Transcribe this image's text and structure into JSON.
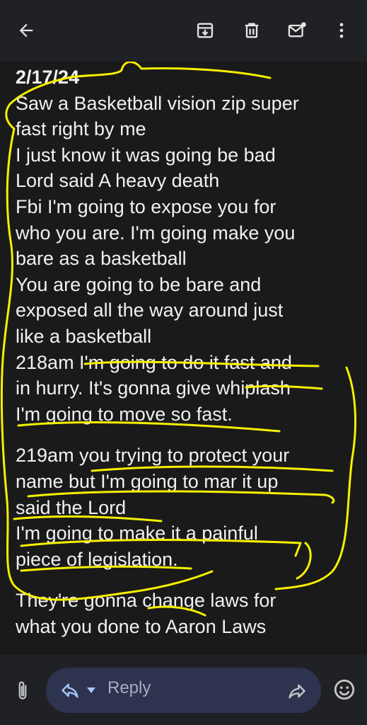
{
  "toolbar": {
    "back_icon": "arrow-left-icon",
    "actions": [
      "archive-icon",
      "trash-icon",
      "mark-unread-icon",
      "more-vert-icon"
    ]
  },
  "message": {
    "date": "2/17/24",
    "paragraphs": [
      [
        "Saw a Basketball vision zip super",
        "fast right by me",
        "I just know it was going be bad",
        "Lord said A heavy death",
        "Fbi I'm going to expose you for",
        "who you are. I'm going make you",
        "bare as a basketball",
        "You are going to be bare and",
        "exposed all the way around just",
        "like a basketball",
        "218am I'm going to do it fast and",
        "in hurry. It's gonna give whiplash",
        "I'm going to move so fast."
      ],
      [
        "219am you trying to protect your",
        "name but I'm going to mar it up",
        "said the Lord",
        "I'm going to make it a painful",
        "piece of legislation."
      ],
      [
        "They're gonna change laws for",
        "what you done to Aaron Laws"
      ]
    ],
    "annotation_color": "#f5f000"
  },
  "compose": {
    "reply_label": "Reply",
    "reply_mode_icon": "reply-icon",
    "forward_icon": "forward-icon",
    "attach_icon": "paperclip-icon",
    "emoji_icon": "emoji-icon",
    "pill_color": "#2e3350"
  }
}
